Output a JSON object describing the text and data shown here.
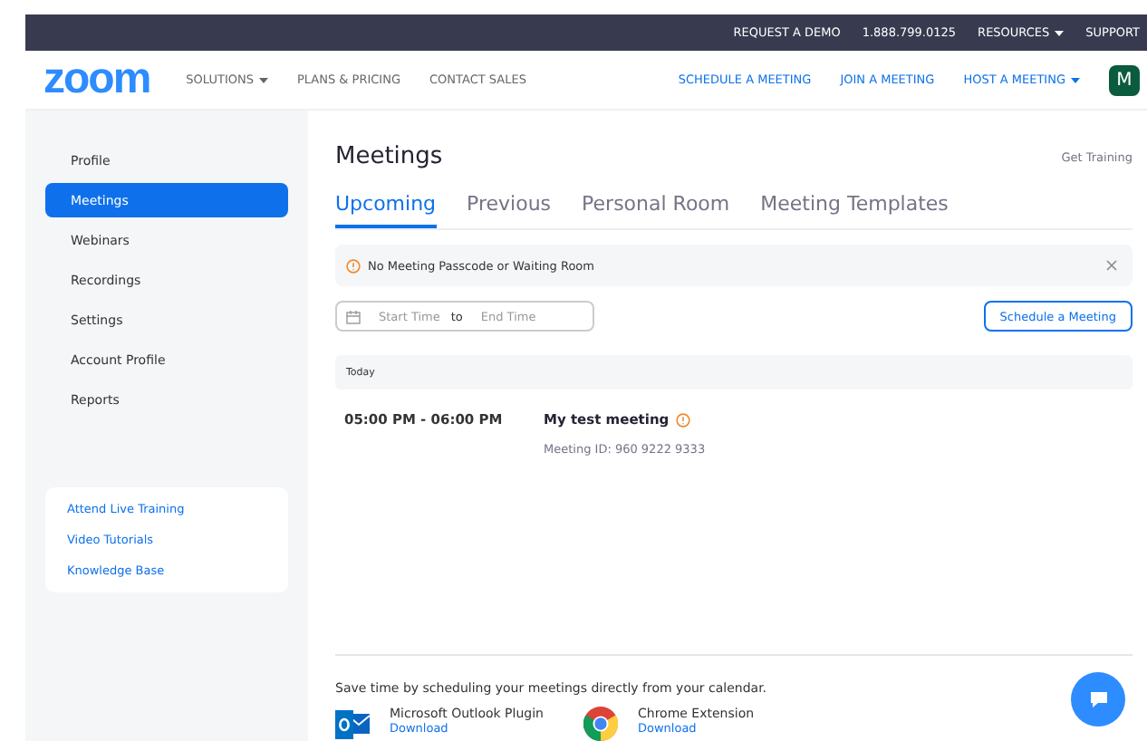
{
  "top_bar": {
    "links": [
      {
        "label": "REQUEST A DEMO",
        "dropdown": false
      },
      {
        "label": "1.888.799.0125",
        "dropdown": false
      },
      {
        "label": "RESOURCES",
        "dropdown": true
      },
      {
        "label": "SUPPORT",
        "dropdown": false
      }
    ]
  },
  "nav": {
    "logo": "zoom",
    "left_links": [
      {
        "label": "SOLUTIONS",
        "dropdown": true
      },
      {
        "label": "PLANS & PRICING",
        "dropdown": false
      },
      {
        "label": "CONTACT SALES",
        "dropdown": false
      }
    ],
    "right_links": [
      {
        "label": "SCHEDULE A MEETING",
        "dropdown": false
      },
      {
        "label": "JOIN A MEETING",
        "dropdown": false
      },
      {
        "label": "HOST A MEETING",
        "dropdown": true
      }
    ],
    "avatar": "M"
  },
  "sidebar": {
    "items": [
      {
        "label": "Profile",
        "selected": false
      },
      {
        "label": "Meetings",
        "selected": true
      },
      {
        "label": "Webinars",
        "selected": false
      },
      {
        "label": "Recordings",
        "selected": false
      },
      {
        "label": "Settings",
        "selected": false
      },
      {
        "label": "Account Profile",
        "selected": false
      },
      {
        "label": "Reports",
        "selected": false
      }
    ],
    "help_links": [
      "Attend Live Training",
      "Video Tutorials",
      "Knowledge Base"
    ]
  },
  "main": {
    "title": "Meetings",
    "get_training": "Get Training",
    "tabs": [
      {
        "label": "Upcoming",
        "selected": true
      },
      {
        "label": "Previous",
        "selected": false
      },
      {
        "label": "Personal Room",
        "selected": false
      },
      {
        "label": "Meeting Templates",
        "selected": false
      }
    ],
    "alert": "No Meeting Passcode or Waiting Room",
    "date_range": {
      "start_placeholder": "Start Time",
      "separator": "to",
      "end_placeholder": "End Time"
    },
    "schedule_button": "Schedule a Meeting",
    "group": "Today",
    "meetings": [
      {
        "time": "05:00 PM - 06:00 PM",
        "title": "My test meeting",
        "warning": true,
        "id": "Meeting ID: 960 9222 9333"
      }
    ],
    "calendar_note": "Save time by scheduling your meetings directly from your calendar.",
    "plugins": [
      {
        "kind": "outlook",
        "name": "Microsoft Outlook Plugin",
        "link": "Download"
      },
      {
        "kind": "chrome",
        "name": "Chrome Extension",
        "link": "Download"
      }
    ]
  }
}
